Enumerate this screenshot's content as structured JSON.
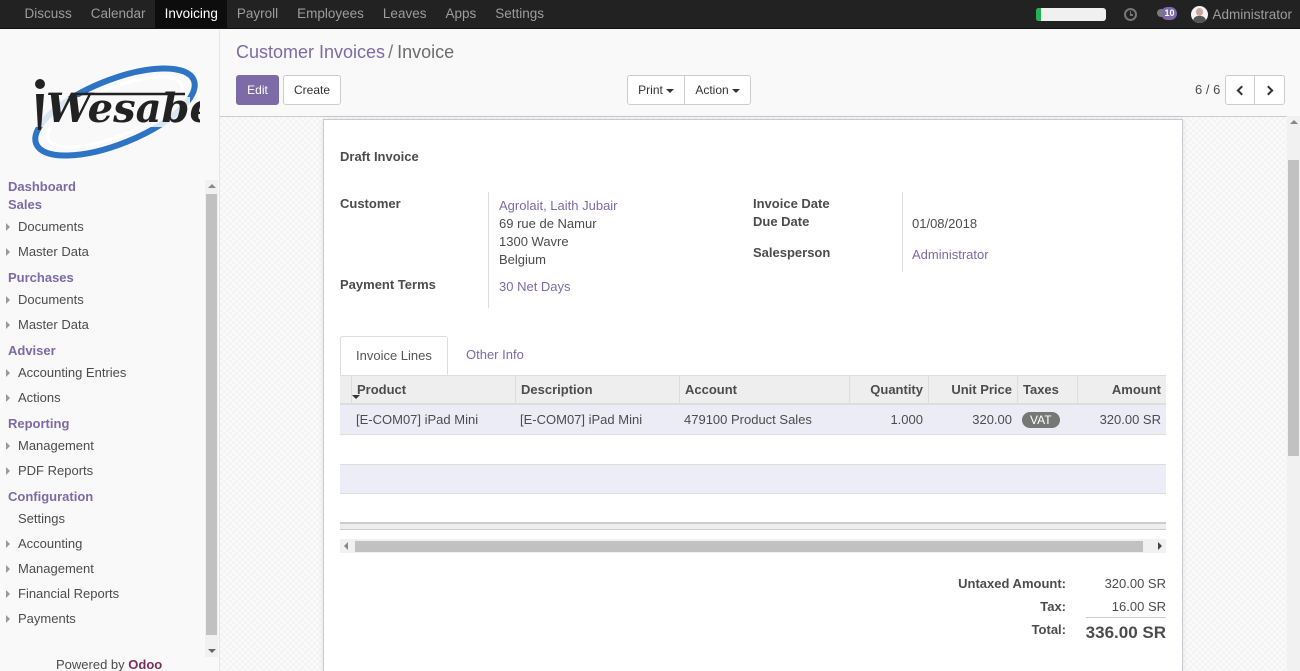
{
  "topbar": {
    "menus": [
      "Discuss",
      "Calendar",
      "Invoicing",
      "Payroll",
      "Employees",
      "Leaves",
      "Apps",
      "Settings"
    ],
    "active_menu": "Invoicing",
    "progress_percent": 6,
    "message_count": "10",
    "user_name": "Administrator",
    "accent_color": "#7c6ba6"
  },
  "sidebar": {
    "logo_text": "iWesabe",
    "sections": [
      {
        "title": "Dashboard",
        "items": []
      },
      {
        "title": "Sales",
        "items": [
          {
            "label": "Documents",
            "expandable": true
          },
          {
            "label": "Master Data",
            "expandable": true
          }
        ]
      },
      {
        "title": "Purchases",
        "items": [
          {
            "label": "Documents",
            "expandable": true
          },
          {
            "label": "Master Data",
            "expandable": true
          }
        ]
      },
      {
        "title": "Adviser",
        "items": [
          {
            "label": "Accounting Entries",
            "expandable": true
          },
          {
            "label": "Actions",
            "expandable": true
          }
        ]
      },
      {
        "title": "Reporting",
        "items": [
          {
            "label": "Management",
            "expandable": true
          },
          {
            "label": "PDF Reports",
            "expandable": true
          }
        ]
      },
      {
        "title": "Configuration",
        "items": [
          {
            "label": "Settings",
            "expandable": false
          },
          {
            "label": "Accounting",
            "expandable": true
          },
          {
            "label": "Management",
            "expandable": true
          },
          {
            "label": "Financial Reports",
            "expandable": true
          },
          {
            "label": "Payments",
            "expandable": true
          }
        ]
      }
    ],
    "powered_by": "Powered by",
    "powered_brand": "Odoo"
  },
  "control_panel": {
    "breadcrumb_parent": "Customer Invoices",
    "breadcrumb_sep": "/",
    "breadcrumb_current": "Invoice",
    "edit_label": "Edit",
    "create_label": "Create",
    "print_label": "Print",
    "action_label": "Action",
    "pager": "6 / 6"
  },
  "form": {
    "status_title": "Draft Invoice",
    "customer_label": "Customer",
    "customer_name": "Agrolait, Laith Jubair",
    "address_line1": "69 rue de Namur",
    "address_line2": "1300 Wavre",
    "address_line3": "Belgium",
    "payment_terms_label": "Payment Terms",
    "payment_terms": "30 Net Days",
    "invoice_date_label": "Invoice Date",
    "invoice_date": "",
    "due_date_label": "Due Date",
    "due_date": "01/08/2018",
    "salesperson_label": "Salesperson",
    "salesperson": "Administrator"
  },
  "tabs": [
    {
      "label": "Invoice Lines",
      "active": true
    },
    {
      "label": "Other Info",
      "active": false
    }
  ],
  "invoice_lines": {
    "columns": [
      "Product",
      "Description",
      "Account",
      "Quantity",
      "Unit Price",
      "Taxes",
      "Amount"
    ],
    "rows": [
      {
        "product": "[E-COM07] iPad Mini",
        "description": "[E-COM07] iPad Mini",
        "account": "479100 Product Sales",
        "quantity": "1.000",
        "unit_price": "320.00",
        "taxes": "VAT",
        "amount": "320.00 SR"
      }
    ]
  },
  "totals": {
    "untaxed_label": "Untaxed Amount:",
    "untaxed_value": "320.00 SR",
    "tax_label": "Tax:",
    "tax_value": "16.00 SR",
    "total_label": "Total:",
    "total_value": "336.00 SR"
  }
}
